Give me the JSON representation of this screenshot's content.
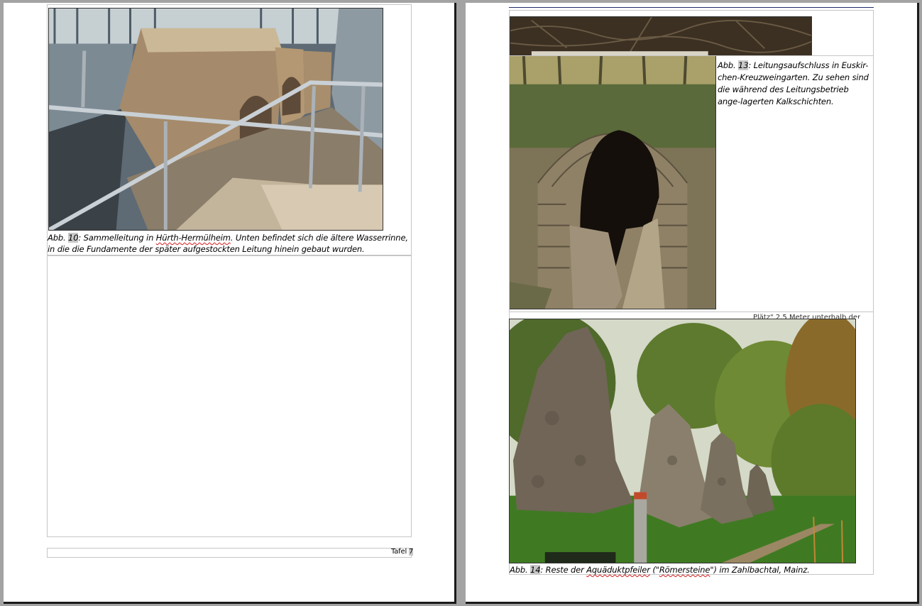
{
  "left_page": {
    "figure10": {
      "abbr": "Abb.",
      "number": "10",
      "sep": ":",
      "text_a": " Sammelleitung in ",
      "place": "Hürth-Hermülheim",
      "text_b": ". Unten befindet sich die ältere Wasserrinne, in die die Fundamente der später aufgestockten Leitung hinein gebaut wurden."
    },
    "footer": {
      "label": "Tafel ",
      "page_number": "7"
    }
  },
  "right_page": {
    "figure13": {
      "abbr": "Abb.",
      "number": "13",
      "sep": ":",
      "text": " Leitungsaufschluss in Euskir-chen-Kreuzweingarten. Zu sehen sind die während des Leitungsbetrieb ange-lagerten Kalkschichten."
    },
    "figure14": {
      "abbr": "Abb.",
      "number": "14",
      "sep": ":",
      "text_a": " Reste der ",
      "word1": "Aquäduktpfeiler",
      "text_b": " (\"",
      "word2": "Römersteine",
      "text_c": "\") im Zahlbachtal, Mainz."
    },
    "hidden_line_fragment": "Plätz\" 2,5 Meter unterhalb der"
  },
  "colors": {
    "background": "#a3a3a3",
    "page": "#ffffff",
    "frame_border": "#c6c6c6",
    "highlight": "#c8c8c8",
    "spellcheck": "#d21818"
  },
  "icons": [
    "aqueduct-ruin-photo",
    "stone-tunnel-photo",
    "roman-pillars-photo",
    "forest-floor-photo"
  ]
}
